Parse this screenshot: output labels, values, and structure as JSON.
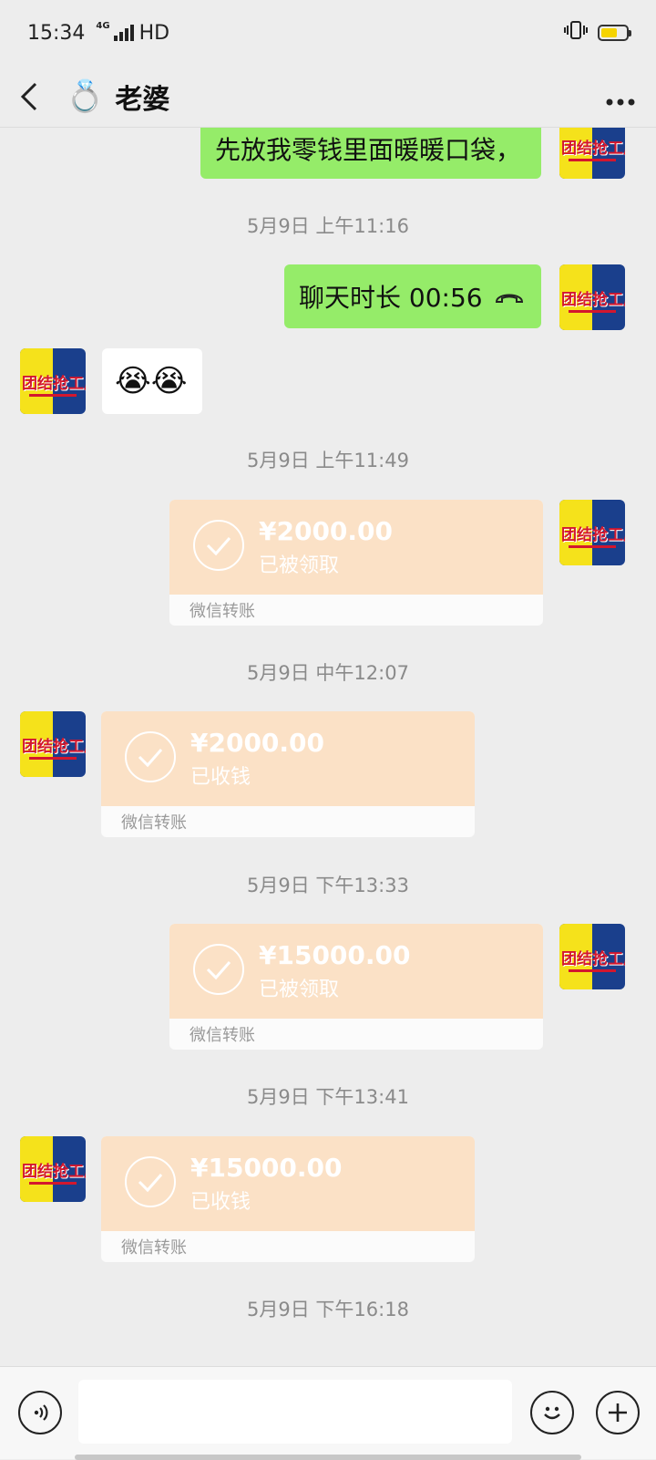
{
  "status_bar": {
    "time": "15:34",
    "network": "4G",
    "hd": "HD"
  },
  "header": {
    "title": "老婆",
    "ring_emoji": "💍"
  },
  "avatar_text": "团结抢工厂",
  "messages": [
    {
      "type": "text",
      "side": "right",
      "text": "先放我零钱里面暖暖口袋，"
    },
    {
      "type": "time",
      "text": "5月9日 上午11:16"
    },
    {
      "type": "call",
      "side": "right",
      "text": "聊天时长 00:56"
    },
    {
      "type": "emoji",
      "side": "left",
      "text": "😭😭"
    },
    {
      "type": "time",
      "text": "5月9日 上午11:49"
    },
    {
      "type": "transfer",
      "side": "right",
      "amount": "¥2000.00",
      "status": "已被领取",
      "footer": "微信转账"
    },
    {
      "type": "time",
      "text": "5月9日 中午12:07"
    },
    {
      "type": "transfer",
      "side": "left",
      "amount": "¥2000.00",
      "status": "已收钱",
      "footer": "微信转账"
    },
    {
      "type": "time",
      "text": "5月9日 下午13:33"
    },
    {
      "type": "transfer",
      "side": "right",
      "amount": "¥15000.00",
      "status": "已被领取",
      "footer": "微信转账"
    },
    {
      "type": "time",
      "text": "5月9日 下午13:41"
    },
    {
      "type": "transfer",
      "side": "left",
      "amount": "¥15000.00",
      "status": "已收钱",
      "footer": "微信转账"
    },
    {
      "type": "time",
      "text": "5月9日 下午16:18"
    }
  ],
  "input": {
    "placeholder": ""
  }
}
